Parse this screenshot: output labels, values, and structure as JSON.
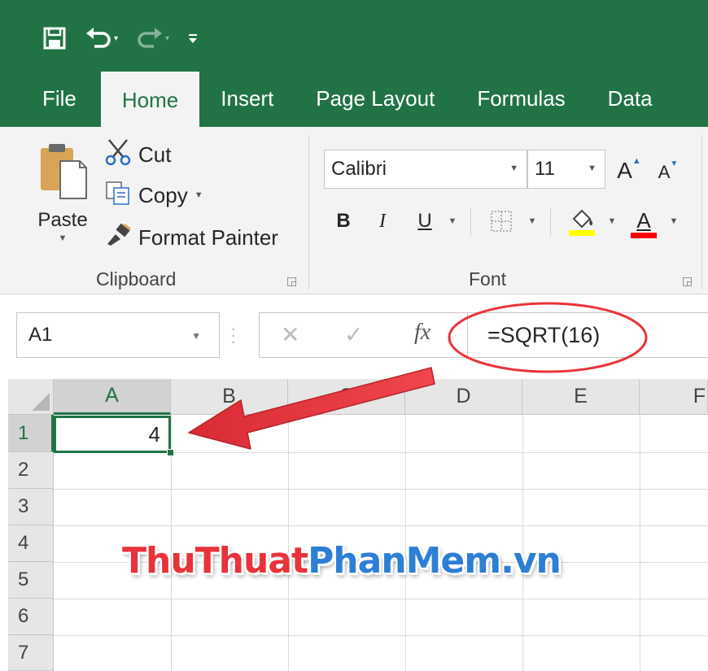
{
  "quick_access": {
    "save_icon": "save-icon",
    "undo_icon": "undo-icon",
    "redo_icon": "redo-icon",
    "customize_icon": "customize-qat-icon"
  },
  "tabs": [
    {
      "label": "File"
    },
    {
      "label": "Home"
    },
    {
      "label": "Insert"
    },
    {
      "label": "Page Layout"
    },
    {
      "label": "Formulas"
    },
    {
      "label": "Data"
    }
  ],
  "clipboard": {
    "paste_label": "Paste",
    "cut_label": "Cut",
    "copy_label": "Copy",
    "format_painter_label": "Format Painter",
    "group_label": "Clipboard"
  },
  "font": {
    "family": "Calibri",
    "size": "11",
    "bold": "B",
    "italic": "I",
    "underline": "U",
    "grow_icon": "A",
    "shrink_icon": "A",
    "font_color_letter": "A",
    "group_label": "Font",
    "fill_color": "#ffff00",
    "font_color": "#ff0000"
  },
  "formula_bar": {
    "name_box": "A1",
    "fx": "fx",
    "formula": "=SQRT(16)"
  },
  "grid": {
    "columns": [
      "A",
      "B",
      "C",
      "D",
      "E",
      "F"
    ],
    "rows": [
      "1",
      "2",
      "3",
      "4",
      "5",
      "6",
      "7"
    ],
    "cell_a1": "4"
  },
  "watermark": {
    "part1": "ThuThuat",
    "part2": "PhanMem.vn"
  },
  "colors": {
    "excel_green": "#217346",
    "annotation_red": "#e8333a"
  }
}
